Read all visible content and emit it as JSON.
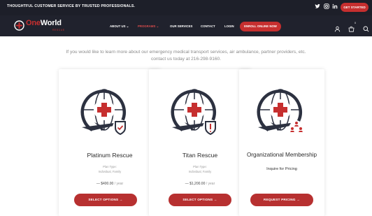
{
  "topbar": {
    "tagline": "THOUGHTFUL CUSTOMER SERVICE BY TRUSTED PROFESSIONALS.",
    "get_started_label": "GET STARTED"
  },
  "brand": {
    "logo_word_one": "One",
    "logo_word_two": "World",
    "logo_sub": "RESCUE"
  },
  "nav": {
    "items": [
      {
        "label": "ABOUT US ⌄"
      },
      {
        "label": "PROGRAMS ⌄"
      },
      {
        "label": "OUR SERVICES"
      },
      {
        "label": "CONTACT"
      },
      {
        "label": "LOGIN"
      }
    ],
    "enroll_label": "ENROLL ONLINE NOW",
    "cart_count": "0"
  },
  "intro": {
    "line1": "If you would like to learn more about our emergency medical transport services, air ambulance, partner providers, etc.",
    "line2": "contact us today at 216-298-9160."
  },
  "cards": [
    {
      "title": "Platinum Rescue",
      "plan_type_label": "Plan Type:",
      "plan_detail": "Individual, Family",
      "price": "— $400.00",
      "per": " / year",
      "button": "SELECT OPTIONS →"
    },
    {
      "title": "Titan Rescue",
      "plan_type_label": "Plan Type:",
      "plan_detail": "Individual, Family",
      "price": "— $1,200.00",
      "per": " / year",
      "button": "SELECT OPTIONS →"
    },
    {
      "title": "Organizational Membership",
      "inquire": "Inquire for Pricing",
      "button": "REQUEST PRICING →"
    }
  ],
  "colors": {
    "brand_red": "#c62f2f",
    "dark_navy": "#20222d"
  }
}
